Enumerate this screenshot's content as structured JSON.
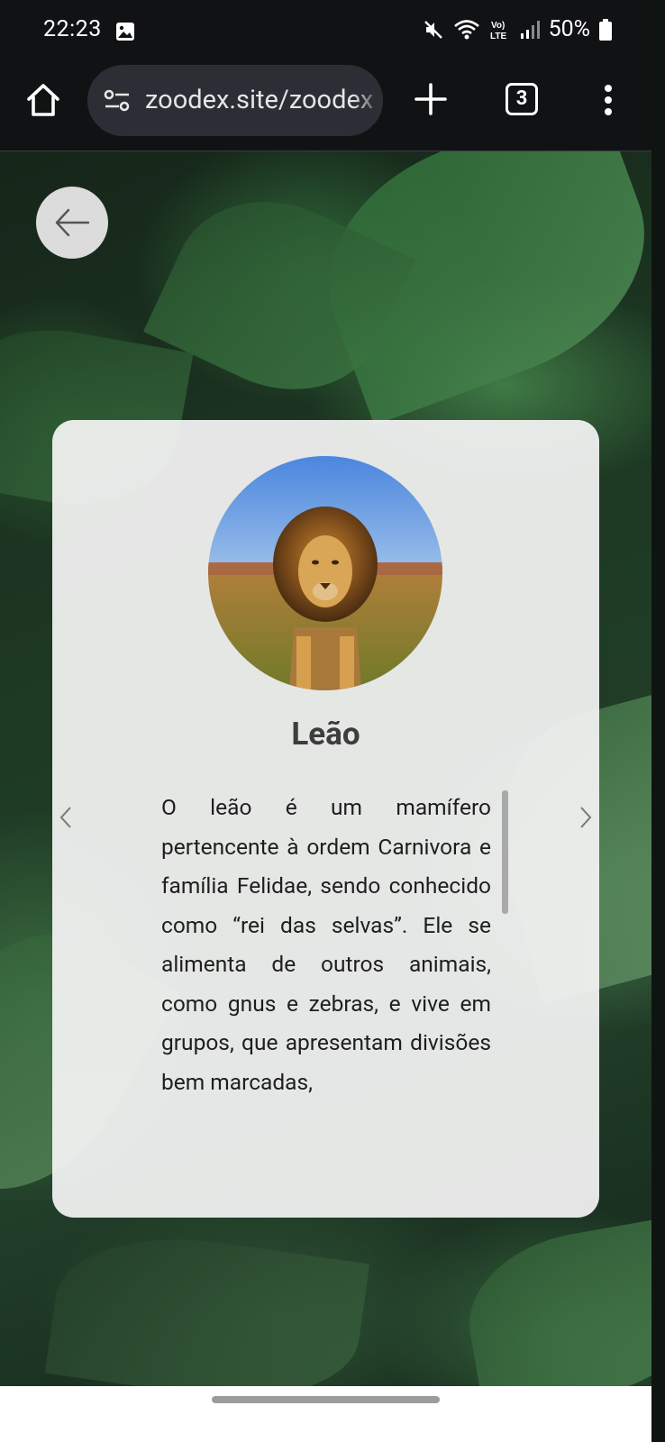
{
  "status_bar": {
    "time": "22:23",
    "battery": "50%",
    "icons": [
      "gallery-icon",
      "mute-icon",
      "wifi-icon",
      "volte-icon",
      "signal-icon",
      "battery-icon"
    ]
  },
  "browser": {
    "url": "zoodex.site/zoodex",
    "tab_count": "3",
    "icons": [
      "home-icon",
      "site-settings-icon",
      "plus-icon",
      "more-vert-icon"
    ]
  },
  "page": {
    "back_icon": "arrow-left-icon",
    "animal": {
      "name": "Leão",
      "description": "O leão é um mamífero pertencente à ordem Carnivora e família Felidae, sendo conhecido como “rei das selvas”. Ele se alimenta de outros animais, como gnus e zebras, e vive em grupos, que apresentam divisões bem marcadas,"
    },
    "nav_icons": [
      "chevron-left-icon",
      "chevron-right-icon"
    ]
  },
  "colors": {
    "bar_bg": "#111214",
    "url_bg": "#2b2e34",
    "card_bg": "#f4f4f4",
    "title": "#3d3d3d",
    "text": "#1e1e1e"
  }
}
